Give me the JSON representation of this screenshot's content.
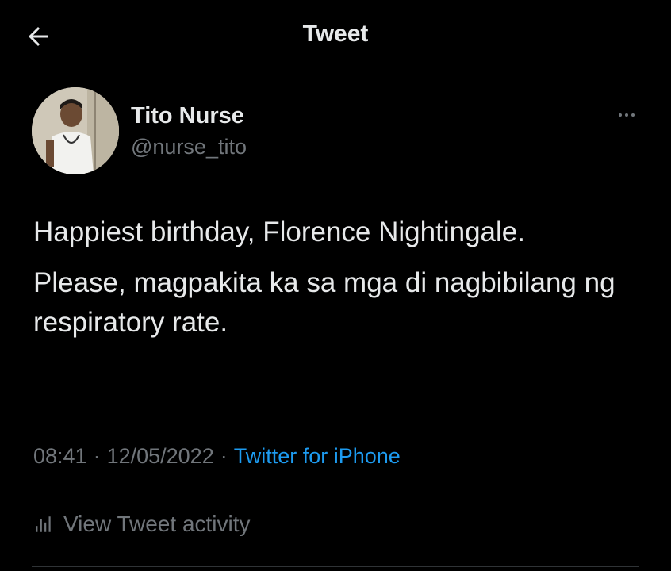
{
  "header": {
    "title": "Tweet",
    "back_icon": "arrow-left-icon"
  },
  "author": {
    "display_name": "Tito Nurse",
    "handle": "@nurse_tito",
    "avatar_icon": "avatar"
  },
  "tweet": {
    "paragraphs": [
      "Happiest birthday, Florence Nightingale.",
      "Please, magpakita ka sa mga di nagbibilang ng respiratory rate."
    ],
    "time": "08:41",
    "separator": "·",
    "date": "12/05/2022",
    "source": "Twitter for iPhone"
  },
  "activity": {
    "label": "View Tweet activity",
    "icon": "analytics-icon"
  },
  "colors": {
    "background": "#000000",
    "text_primary": "#e7e9ea",
    "text_secondary": "#71767b",
    "link": "#1d9bf0",
    "divider": "#2f3336"
  }
}
